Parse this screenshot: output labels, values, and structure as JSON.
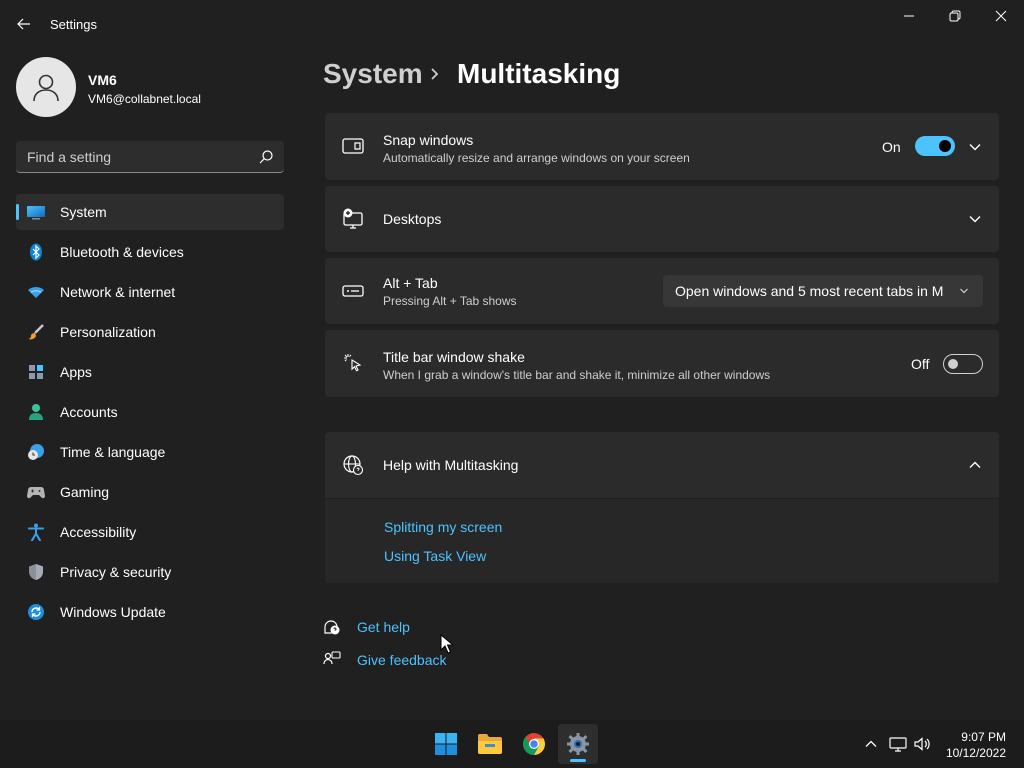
{
  "window": {
    "app_title": "Settings"
  },
  "profile": {
    "name": "VM6",
    "email": "VM6@collabnet.local"
  },
  "search": {
    "placeholder": "Find a setting"
  },
  "sidebar": {
    "items": [
      {
        "label": "System",
        "icon": "system-icon",
        "active": true
      },
      {
        "label": "Bluetooth & devices",
        "icon": "bluetooth-icon"
      },
      {
        "label": "Network & internet",
        "icon": "wifi-icon"
      },
      {
        "label": "Personalization",
        "icon": "brush-icon"
      },
      {
        "label": "Apps",
        "icon": "apps-icon"
      },
      {
        "label": "Accounts",
        "icon": "accounts-icon"
      },
      {
        "label": "Time & language",
        "icon": "globe-clock-icon"
      },
      {
        "label": "Gaming",
        "icon": "gamepad-icon"
      },
      {
        "label": "Accessibility",
        "icon": "accessibility-icon"
      },
      {
        "label": "Privacy & security",
        "icon": "shield-icon"
      },
      {
        "label": "Windows Update",
        "icon": "update-icon"
      }
    ]
  },
  "header": {
    "parent": "System",
    "current": "Multitasking"
  },
  "settings": {
    "snap": {
      "title": "Snap windows",
      "description": "Automatically resize and arrange windows on your screen",
      "state": "On"
    },
    "desktops": {
      "title": "Desktops"
    },
    "alttab": {
      "title": "Alt + Tab",
      "description": "Pressing Alt + Tab shows",
      "selected": "Open windows and 5 most recent tabs in M"
    },
    "shake": {
      "title": "Title bar window shake",
      "description": "When I grab a window's title bar and shake it, minimize all other windows",
      "state": "Off"
    }
  },
  "help": {
    "title": "Help with Multitasking",
    "links": [
      "Splitting my screen",
      "Using Task View"
    ]
  },
  "footer": {
    "get_help": "Get help",
    "give_feedback": "Give feedback"
  },
  "taskbar": {
    "time": "9:07 PM",
    "date": "10/12/2022"
  },
  "colors": {
    "accent": "#4cc2ff",
    "background": "#202020",
    "card": "#2b2b2b"
  }
}
